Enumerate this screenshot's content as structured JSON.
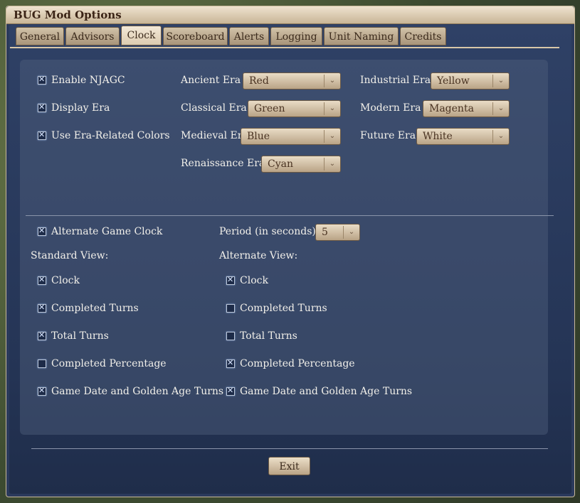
{
  "window": {
    "title": "BUG Mod Options"
  },
  "tabs": [
    "General",
    "Advisors",
    "Clock",
    "Scoreboard",
    "Alerts",
    "Logging",
    "Unit Naming",
    "Credits"
  ],
  "active_tab": "Clock",
  "top_options": [
    {
      "label": "Enable NJAGC",
      "checked": true
    },
    {
      "label": "Display Era",
      "checked": true
    },
    {
      "label": "Use Era-Related Colors",
      "checked": true
    }
  ],
  "era_colors": [
    {
      "label": "Ancient Era",
      "value": "Red"
    },
    {
      "label": "Classical Era",
      "value": "Green"
    },
    {
      "label": "Medieval Era",
      "value": "Blue"
    },
    {
      "label": "Renaissance Era",
      "value": "Cyan"
    },
    {
      "label": "Industrial Era",
      "value": "Yellow"
    },
    {
      "label": "Modern Era",
      "value": "Magenta"
    },
    {
      "label": "Future Era",
      "value": "White"
    }
  ],
  "alternate": {
    "label": "Alternate Game Clock",
    "checked": true,
    "period_label": "Period (in seconds)",
    "period_value": "5"
  },
  "standard_view": {
    "title": "Standard View:",
    "items": [
      {
        "label": "Clock",
        "checked": true
      },
      {
        "label": "Completed Turns",
        "checked": true
      },
      {
        "label": "Total Turns",
        "checked": true
      },
      {
        "label": "Completed Percentage",
        "checked": false
      },
      {
        "label": "Game Date and Golden Age Turns",
        "checked": true
      }
    ]
  },
  "alternate_view": {
    "title": "Alternate View:",
    "items": [
      {
        "label": "Clock",
        "checked": true
      },
      {
        "label": "Completed Turns",
        "checked": false
      },
      {
        "label": "Total Turns",
        "checked": false
      },
      {
        "label": "Completed Percentage",
        "checked": true
      },
      {
        "label": "Game Date and Golden Age Turns",
        "checked": true
      }
    ]
  },
  "exit_label": "Exit"
}
